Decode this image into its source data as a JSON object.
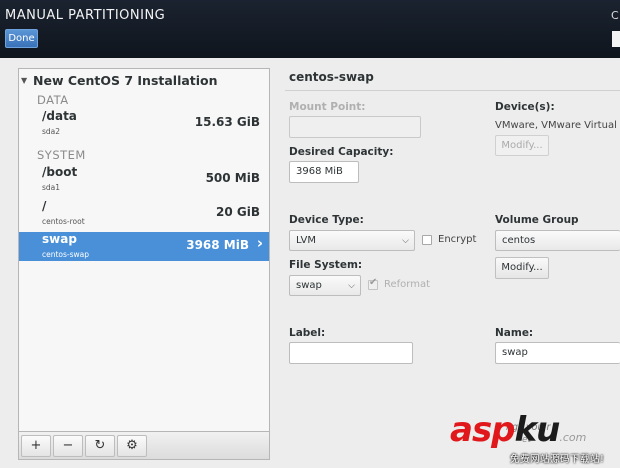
{
  "header": {
    "title": "MANUAL PARTITIONING",
    "done_label": "Done",
    "right_glyph": "C"
  },
  "install": {
    "title": "New CentOS 7 Installation",
    "groups": [
      {
        "label": "DATA",
        "mounts": [
          {
            "name": "/data",
            "device": "sda2",
            "size": "15.63 GiB"
          }
        ]
      },
      {
        "label": "SYSTEM",
        "mounts": [
          {
            "name": "/boot",
            "device": "sda1",
            "size": "500 MiB"
          },
          {
            "name": "/",
            "device": "centos-root",
            "size": "20 GiB"
          },
          {
            "name": "swap",
            "device": "centos-swap",
            "size": "3968 MiB",
            "selected": true
          }
        ]
      }
    ],
    "toolbar": {
      "add": "+",
      "remove": "−",
      "refresh": "↻",
      "config": "⚙"
    }
  },
  "detail": {
    "title": "centos-swap",
    "mount_point_label": "Mount Point:",
    "mount_point_value": "",
    "desired_capacity_label": "Desired Capacity:",
    "desired_capacity_value": "3968 MiB",
    "devices_label": "Device(s):",
    "devices_value": "VMware, VMware Virtual S",
    "modify_devices_label": "Modify...",
    "device_type_label": "Device Type:",
    "device_type_value": "LVM",
    "encrypt_label": "Encrypt",
    "encrypt_checked": false,
    "volume_group_label": "Volume Group",
    "volume_group_value": "centos",
    "modify_vg_label": "Modify...",
    "file_system_label": "File System:",
    "file_system_value": "swap",
    "reformat_label": "Reformat",
    "reformat_checked": true,
    "label_label": "Label:",
    "label_value": "",
    "name_label": "Name:",
    "name_value": "swap"
  },
  "watermark": {
    "brand_a": "asp",
    "brand_b": "ku",
    "suffix": ".com",
    "tagline": "免费网站源码下载站!",
    "obscured_1": "ngs you r",
    "obscured_2": "et"
  },
  "colors": {
    "selected_row": "#4a90d9",
    "done_button": "#4a86c8",
    "topbar": "#151c26",
    "brand_red": "#e0181b"
  }
}
